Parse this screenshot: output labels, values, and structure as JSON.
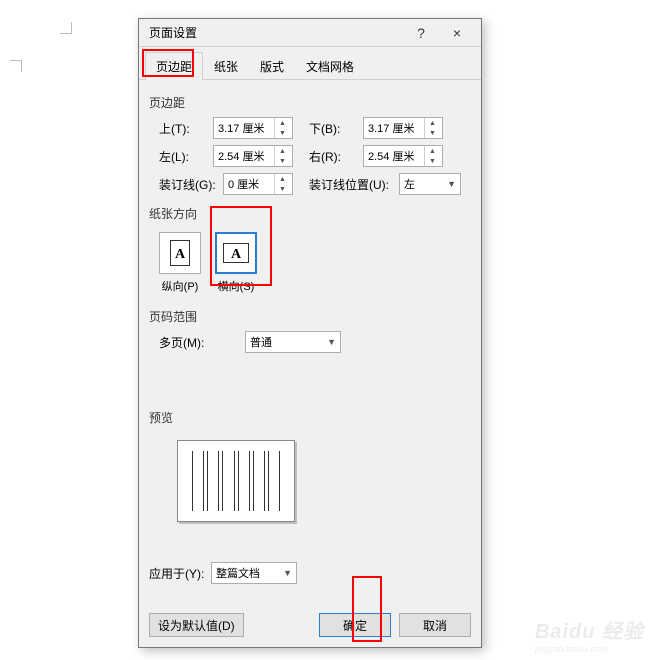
{
  "dialog": {
    "title": "页面设置",
    "help": "?",
    "close": "×"
  },
  "tabs": {
    "margins": "页边距",
    "paper": "纸张",
    "layout": "版式",
    "grid": "文档网格"
  },
  "margins": {
    "group": "页边距",
    "top_label": "上(T):",
    "top_value": "3.17 厘米",
    "bottom_label": "下(B):",
    "bottom_value": "3.17 厘米",
    "left_label": "左(L):",
    "left_value": "2.54 厘米",
    "right_label": "右(R):",
    "right_value": "2.54 厘米",
    "gutter_label": "装订线(G):",
    "gutter_value": "0 厘米",
    "gutter_pos_label": "装订线位置(U):",
    "gutter_pos_value": "左"
  },
  "orientation": {
    "group": "纸张方向",
    "portrait": "纵向(P)",
    "landscape": "横向(S)"
  },
  "pages": {
    "group": "页码范围",
    "multi_label": "多页(M):",
    "multi_value": "普通"
  },
  "preview": {
    "group": "预览"
  },
  "apply": {
    "label": "应用于(Y):",
    "value": "整篇文档"
  },
  "footer": {
    "default": "设为默认值(D)",
    "ok": "确定",
    "cancel": "取消"
  },
  "watermark": {
    "brand": "Baidu 经验",
    "sub": "jingyan.baidu.com"
  }
}
